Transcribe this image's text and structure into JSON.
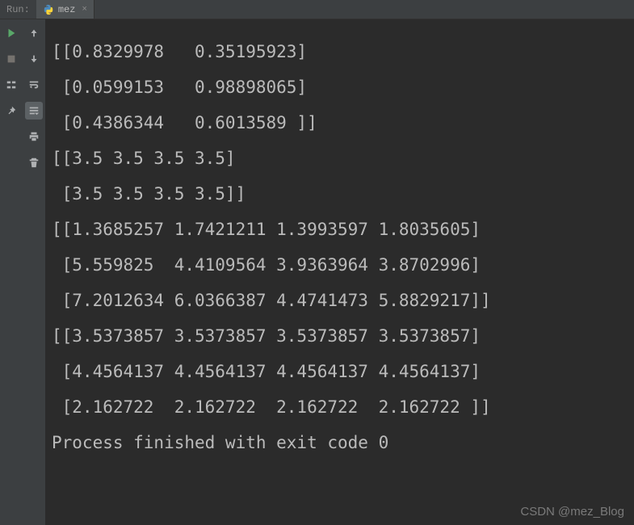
{
  "topbar": {
    "run_label": "Run:",
    "tab_name": "mez",
    "tab_close": "×"
  },
  "console": {
    "lines": [
      "[[0.8329978   0.35195923]",
      " [0.0599153   0.98898065]",
      " [0.4386344   0.6013589 ]]",
      "[[3.5 3.5 3.5 3.5]",
      " [3.5 3.5 3.5 3.5]]",
      "[[1.3685257 1.7421211 1.3993597 1.8035605]",
      " [5.559825  4.4109564 3.9363964 3.8702996]",
      " [7.2012634 6.0366387 4.4741473 5.8829217]]",
      "[[3.5373857 3.5373857 3.5373857 3.5373857]",
      " [4.4564137 4.4564137 4.4564137 4.4564137]",
      " [2.162722  2.162722  2.162722  2.162722 ]]",
      "",
      "Process finished with exit code 0"
    ]
  },
  "watermark": "CSDN @mez_Blog"
}
